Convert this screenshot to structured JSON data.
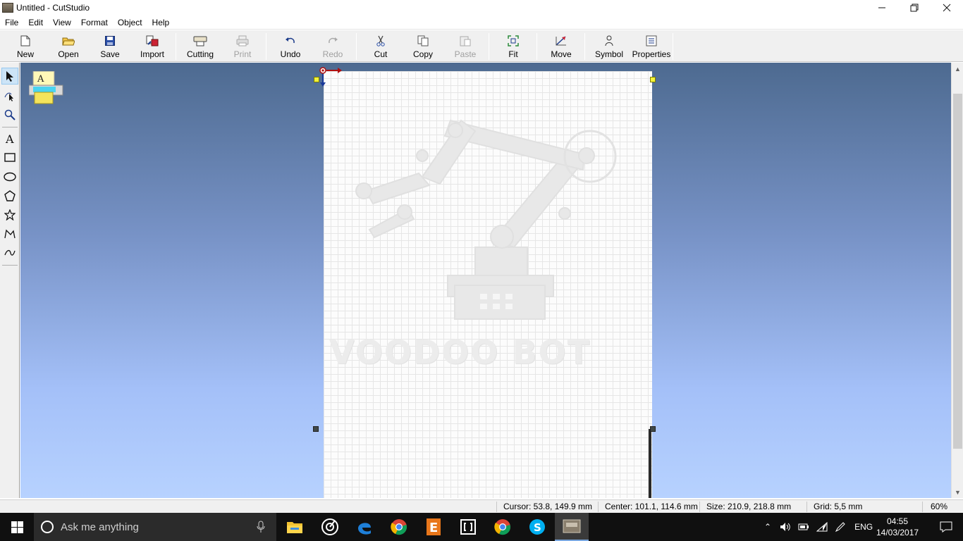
{
  "window": {
    "title": "Untitled - CutStudio"
  },
  "menu": [
    "File",
    "Edit",
    "View",
    "Format",
    "Object",
    "Help"
  ],
  "toolbar": {
    "new": "New",
    "open": "Open",
    "save": "Save",
    "import": "Import",
    "cutting": "Cutting",
    "print": "Print",
    "undo": "Undo",
    "redo": "Redo",
    "cut": "Cut",
    "copy": "Copy",
    "paste": "Paste",
    "fit": "Fit",
    "move": "Move",
    "symbol": "Symbol",
    "properties": "Properties"
  },
  "canvas": {
    "watermark_text": "VOODOO BOT"
  },
  "status": {
    "cursor": "Cursor: 53.8, 149.9 mm",
    "center": "Center: 101.1, 114.6 mm",
    "size": "Size: 210.9, 218.8 mm",
    "grid": "Grid: 5,5 mm",
    "zoom": "60%"
  },
  "taskbar": {
    "search_placeholder": "Ask me anything",
    "language": "ENG",
    "time": "04:55",
    "date": "14/03/2017"
  }
}
